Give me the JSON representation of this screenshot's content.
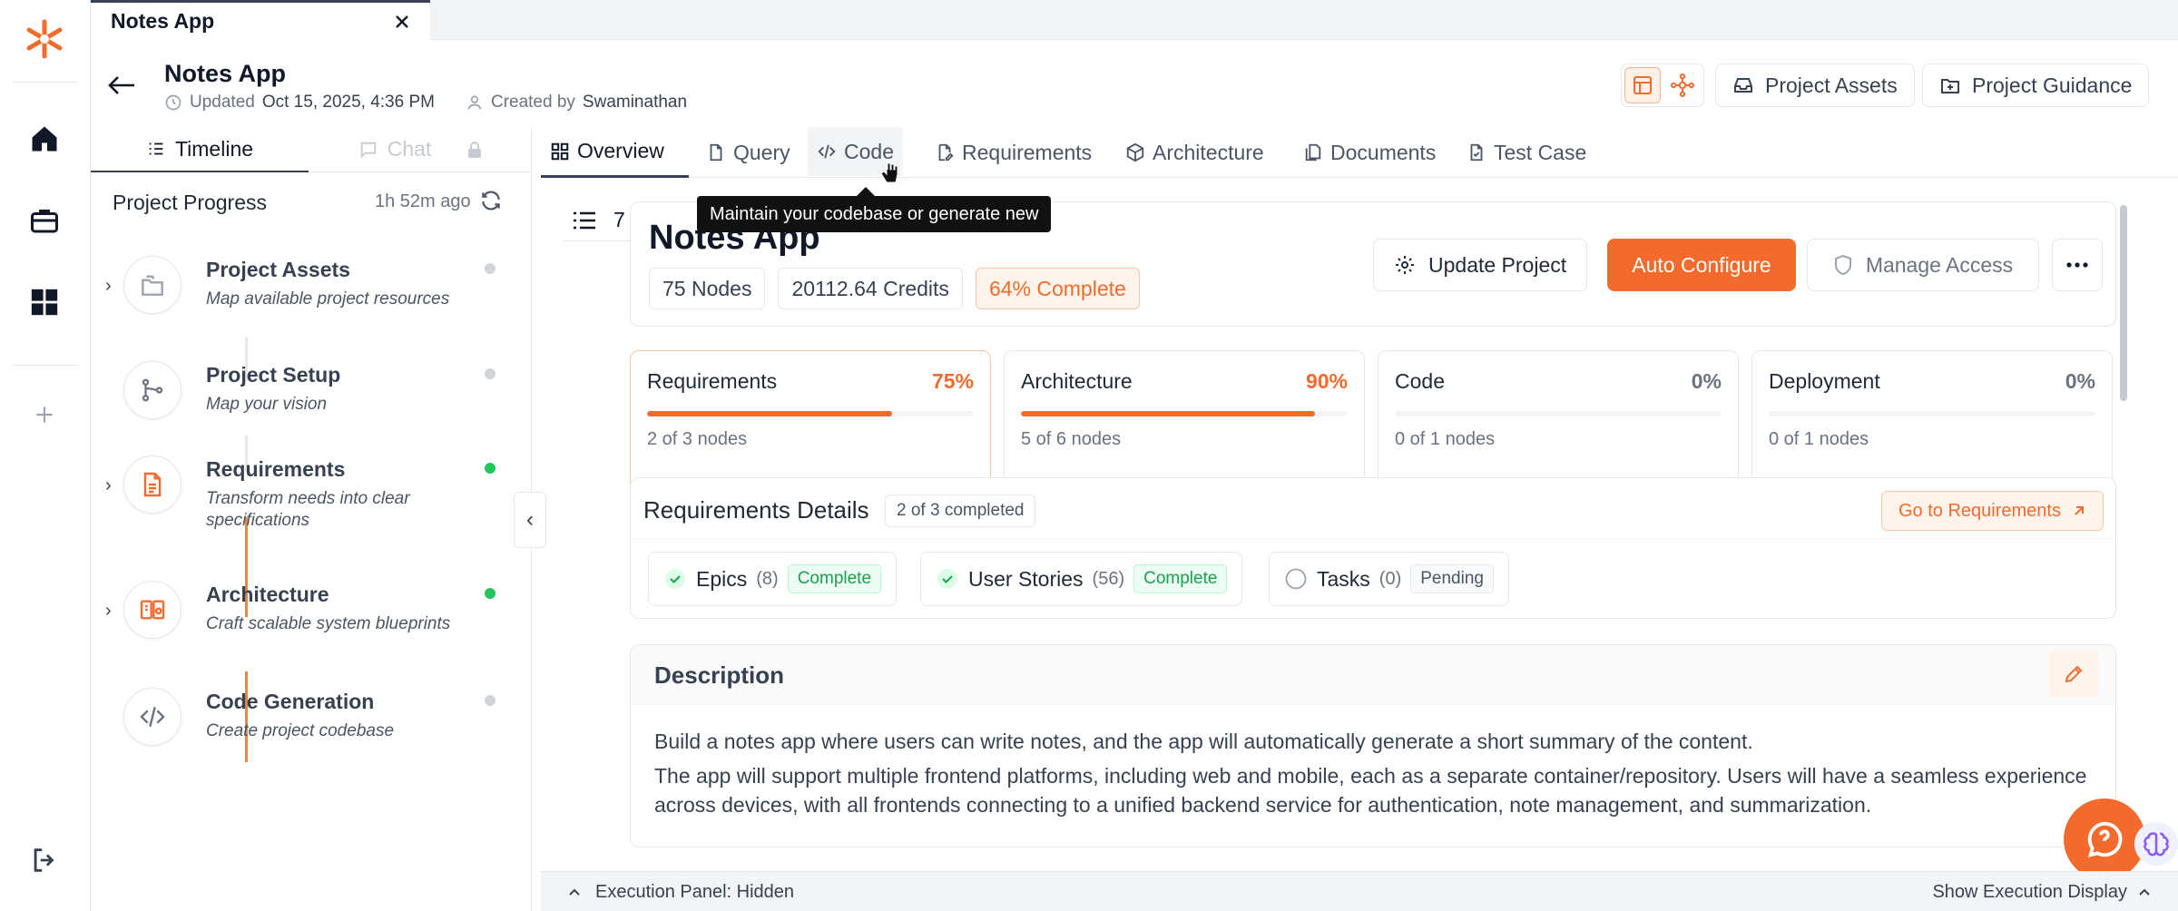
{
  "window_tab": {
    "title": "Notes App"
  },
  "header": {
    "title": "Notes App",
    "updated_label": "Updated",
    "updated_value": "Oct 15, 2025, 4:36 PM",
    "created_label": "Created by",
    "created_value": "Swaminathan",
    "assets_btn": "Project Assets",
    "guidance_btn": "Project Guidance"
  },
  "panel": {
    "tab_timeline": "Timeline",
    "tab_chat": "Chat",
    "progress_title": "Project Progress",
    "progress_time": "1h 52m ago",
    "steps": [
      {
        "title": "Project Assets",
        "desc": "Map available project resources",
        "status": "pending"
      },
      {
        "title": "Project Setup",
        "desc": "Map your vision",
        "status": "pending"
      },
      {
        "title": "Requirements",
        "desc": "Transform needs into clear specifications",
        "status": "done"
      },
      {
        "title": "Architecture",
        "desc": "Craft scalable system blueprints",
        "status": "done"
      },
      {
        "title": "Code Generation",
        "desc": "Create project codebase",
        "status": "pending"
      }
    ]
  },
  "main_tabs": [
    "Overview",
    "Query",
    "Code",
    "Requirements",
    "Architecture",
    "Documents",
    "Test Case"
  ],
  "tooltip": "Maintain your codebase or generate new",
  "list_count": "7",
  "project": {
    "title": "Notes App",
    "nodes": "75 Nodes",
    "credits": "20112.64 Credits",
    "complete": "64% Complete",
    "update_btn": "Update Project",
    "auto_btn": "Auto Configure",
    "access_btn": "Manage Access"
  },
  "progress_cards": [
    {
      "name": "Requirements",
      "pct": "75%",
      "value": 0.75,
      "sub": "2 of 3 nodes"
    },
    {
      "name": "Architecture",
      "pct": "90%",
      "value": 0.9,
      "sub": "5 of 6 nodes"
    },
    {
      "name": "Code",
      "pct": "0%",
      "value": 0,
      "sub": "0 of 1 nodes"
    },
    {
      "name": "Deployment",
      "pct": "0%",
      "value": 0,
      "sub": "0 of 1 nodes"
    }
  ],
  "req_details": {
    "title": "Requirements Details",
    "badge": "2 of 3 completed",
    "goto": "Go to Requirements",
    "items": [
      {
        "name": "Epics",
        "count": "(8)",
        "status": "Complete"
      },
      {
        "name": "User Stories",
        "count": "(56)",
        "status": "Complete"
      },
      {
        "name": "Tasks",
        "count": "(0)",
        "status": "Pending"
      }
    ]
  },
  "description": {
    "title": "Description",
    "p1": "Build a notes app where users can write notes, and the app will automatically generate a short summary of the content.",
    "p2": "The app will support multiple frontend platforms, including web and mobile, each as a separate container/repository. Users will have a seamless experience across devices, with all frontends connecting to a unified backend service for authentication, note management, and summarization."
  },
  "bottom_bar": {
    "left": "Execution Panel: Hidden",
    "right": "Show Execution Display"
  },
  "colors": {
    "accent": "#f26b2c",
    "success": "#22c55e",
    "border": "#e5e7eb"
  }
}
